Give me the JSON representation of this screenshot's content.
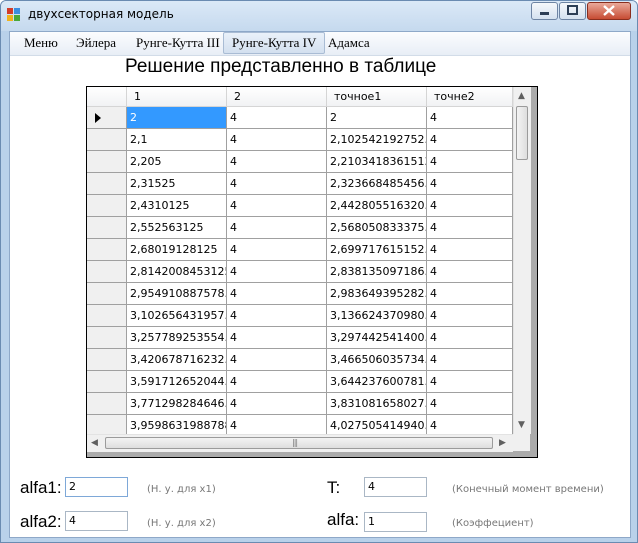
{
  "window": {
    "title": "двухсекторная модель"
  },
  "menu": [
    "Меню",
    "Эйлера",
    "Рунге-Кутта III",
    "Рунге-Кутта IV",
    "Адамса"
  ],
  "heading": "Решение представленно в таблице",
  "grid": {
    "columns": [
      "1",
      "2",
      "точное1",
      "точне2"
    ],
    "rows": [
      [
        "2",
        "4",
        "2",
        "4"
      ],
      [
        "2,1",
        "4",
        "2,102542192752...",
        "4"
      ],
      [
        "2,205",
        "4",
        "2,2103418361513",
        "4"
      ],
      [
        "2,31525",
        "4",
        "2,323668485456...",
        "4"
      ],
      [
        "2,4310125",
        "4",
        "2,442805516320...",
        "4"
      ],
      [
        "2,552563125",
        "4",
        "2,568050833375...",
        "4"
      ],
      [
        "2,68019128125",
        "4",
        "2,699717615152...",
        "4"
      ],
      [
        "2,8142008453125",
        "4",
        "2,838135097186...",
        "4"
      ],
      [
        "2,954910887578...",
        "4",
        "2,983649395282...",
        "4"
      ],
      [
        "3,102656431957...",
        "4",
        "3,136624370980...",
        "4"
      ],
      [
        "3,257789253554...",
        "4",
        "3,297442541400...",
        "4"
      ],
      [
        "3,420678716232...",
        "4",
        "3,466506035734...",
        "4"
      ],
      [
        "3,591712652044...",
        "4",
        "3,644237600781...",
        "4"
      ],
      [
        "3,771298284646...",
        "4",
        "3,831081658027...",
        "4"
      ],
      [
        "3,9598631988788",
        "4",
        "4,027505414940...",
        "4"
      ]
    ]
  },
  "params": {
    "alfa1": {
      "label": "alfa1:",
      "value": "2",
      "hint": "(Н. у. для x1)"
    },
    "alfa2": {
      "label": "alfa2:",
      "value": "4",
      "hint": "(Н. у. для x2)"
    },
    "T": {
      "label": "T:",
      "value": "4",
      "hint": "(Конечный момент времени)"
    },
    "alfa": {
      "label": "alfa:",
      "value": "1",
      "hint": "(Коэффециент)"
    }
  }
}
